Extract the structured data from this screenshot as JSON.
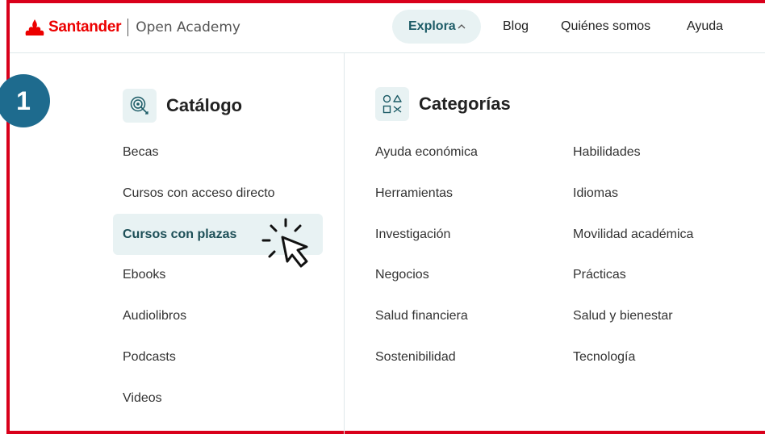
{
  "header": {
    "brand": "Santander",
    "brand_sub": "Open Academy",
    "nav": {
      "explora": "Explora",
      "blog": "Blog",
      "quienes": "Quiénes somos",
      "ayuda": "Ayuda"
    }
  },
  "badge": "1",
  "catalog": {
    "title": "Catálogo",
    "items": [
      "Becas",
      "Cursos con acceso directo",
      "Cursos con plazas",
      "Ebooks",
      "Audiolibros",
      "Podcasts",
      "Videos"
    ]
  },
  "categories": {
    "title": "Categorías",
    "col1": [
      "Ayuda económica",
      "Herramientas",
      "Investigación",
      "Negocios",
      "Salud financiera",
      "Sostenibilidad"
    ],
    "col2": [
      "Habilidades",
      "Idiomas",
      "Movilidad académica",
      "Prácticas",
      "Salud y bienestar",
      "Tecnología"
    ]
  },
  "colors": {
    "brand_red": "#ec0000",
    "annotation_red": "#d9001b",
    "badge_blue": "#1e6b8e",
    "active_bg": "#e8f2f3",
    "active_text": "#1d4f57"
  },
  "icons": {
    "logo": "santander-flame-icon",
    "catalog": "target-search-icon",
    "categories": "shapes-icon",
    "explora_chevron": "chevron-up-icon",
    "pointer": "click-cursor-icon"
  }
}
